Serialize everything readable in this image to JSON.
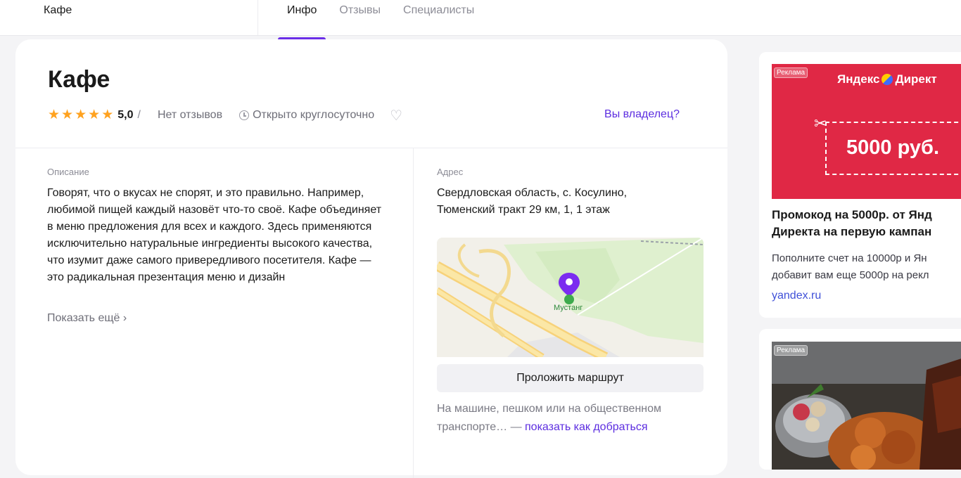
{
  "nav": {
    "breadcrumb": "Кафе",
    "tabs": [
      {
        "label": "Инфо",
        "active": true
      },
      {
        "label": "Отзывы",
        "active": false
      },
      {
        "label": "Специалисты",
        "active": false
      }
    ]
  },
  "business": {
    "name": "Кафе",
    "stars": 5,
    "rating": "5,0",
    "rating_separator": "/",
    "reviews": "Нет отзывов",
    "hours": "Открыто круглосуточно",
    "owner_link": "Вы владелец?"
  },
  "description": {
    "label": "Описание",
    "text": "Говорят, что о вкусах не спорят, и это правильно. Например, любимой пищей каждый назовёт что-то своё. Кафе объединяет в меню предложения для всех и каждого. Здесь применяются исключительно натуральные ингредиенты высокого качества, что изумит даже самого привередливого посетителя. Кафе — это радикальная презентация меню и дизайн",
    "show_more": "Показать ещё ›"
  },
  "address": {
    "label": "Адрес",
    "line1": "Свердловская область, с. Косулино,",
    "line2": "Тюменский тракт 29 км, 1, 1 этаж",
    "map_pin_label": "Мустанг",
    "route_button": "Проложить маршрут",
    "route_note_prefix": "На машине, пешком или на общественном транспорте… — ",
    "route_note_link": "показать как добраться"
  },
  "ads": [
    {
      "tag": "Реклама",
      "brand_left": "Яндекс",
      "brand_right": "Директ",
      "amount": "5000 руб.",
      "title_line1": "Промокод на 5000р. от Янд",
      "title_line2": "Директа на первую кампан",
      "text_line1": "Пополните счет на 10000р и Ян",
      "text_line2": "добавит вам еще 5000р на рекл",
      "domain": "yandex.ru",
      "banner_color": "#e02845"
    },
    {
      "tag": "Реклама"
    }
  ],
  "colors": {
    "accent": "#6b2ee8",
    "link": "#5c2de0",
    "star": "#ffa21f",
    "pin": "#7b2cf0"
  }
}
